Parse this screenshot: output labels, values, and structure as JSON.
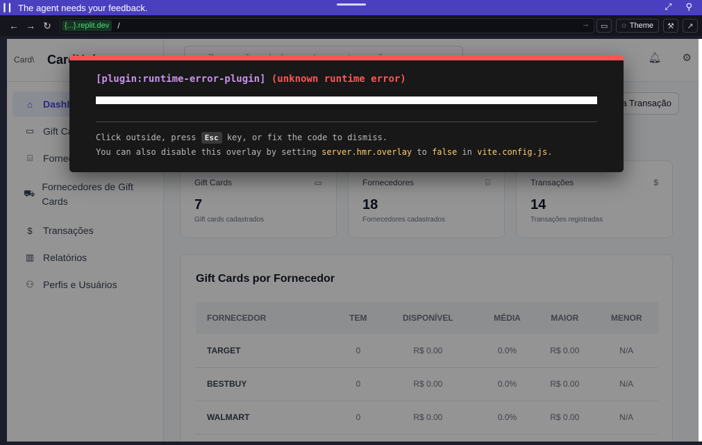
{
  "agent_bar": {
    "message": "The agent needs your feedback."
  },
  "browser": {
    "url_domain": "{...}.replit.dev",
    "url_path": "/",
    "theme_label": "Theme"
  },
  "sidebar": {
    "logo_alt": "Card\\",
    "brand": "CardHub",
    "items": [
      {
        "label": "Dashboard",
        "icon": "home-icon"
      },
      {
        "label": "Gift Cards",
        "icon": "credit-card-icon"
      },
      {
        "label": "Fornecedores",
        "icon": "store-icon"
      },
      {
        "label": "Fornecedores de Gift Cards",
        "icon": "cart-icon"
      },
      {
        "label": "Transações",
        "icon": "receipt-icon"
      },
      {
        "label": "Relatórios",
        "icon": "bar-chart-icon"
      },
      {
        "label": "Perfis e Usuários",
        "icon": "users-icon"
      }
    ]
  },
  "topbar": {
    "search_placeholder": "Buscar gift cards, fornecedores ou transações..."
  },
  "actions": {
    "new_transaction": "Nova Transação"
  },
  "stats": [
    {
      "title": "Gift Cards",
      "value": "7",
      "sub": "Gift cards cadastrados",
      "icon": "credit-card-icon"
    },
    {
      "title": "Fornecedores",
      "value": "18",
      "sub": "Fornecedores cadastrados",
      "icon": "store-icon"
    },
    {
      "title": "Transações",
      "value": "14",
      "sub": "Transações registradas",
      "icon": "receipt-icon"
    }
  ],
  "table": {
    "title": "Gift Cards por Fornecedor",
    "headers": [
      "FORNECEDOR",
      "TEM",
      "DISPONÍVEL",
      "MÉDIA",
      "MAIOR",
      "MENOR"
    ],
    "rows": [
      [
        "TARGET",
        "0",
        "R$ 0.00",
        "0.0%",
        "R$ 0.00",
        "N/A"
      ],
      [
        "BESTBUY",
        "0",
        "R$ 0.00",
        "0.0%",
        "R$ 0.00",
        "N/A"
      ],
      [
        "WALMART",
        "0",
        "R$ 0.00",
        "0.0%",
        "R$ 0.00",
        "N/A"
      ]
    ]
  },
  "error_overlay": {
    "plugin": "[plugin:runtime-error-plugin]",
    "message": "(unknown runtime error)",
    "tip1_before": "Click outside, press ",
    "tip1_key": "Esc",
    "tip1_after": " key, or fix the code to dismiss.",
    "tip2_before": "You can also disable this overlay by setting ",
    "tip2_code1": "server.hmr.overlay",
    "tip2_mid": " to ",
    "tip2_code2": "false",
    "tip2_in": " in ",
    "tip2_code3": "vite.config.js",
    "tip2_end": "."
  }
}
